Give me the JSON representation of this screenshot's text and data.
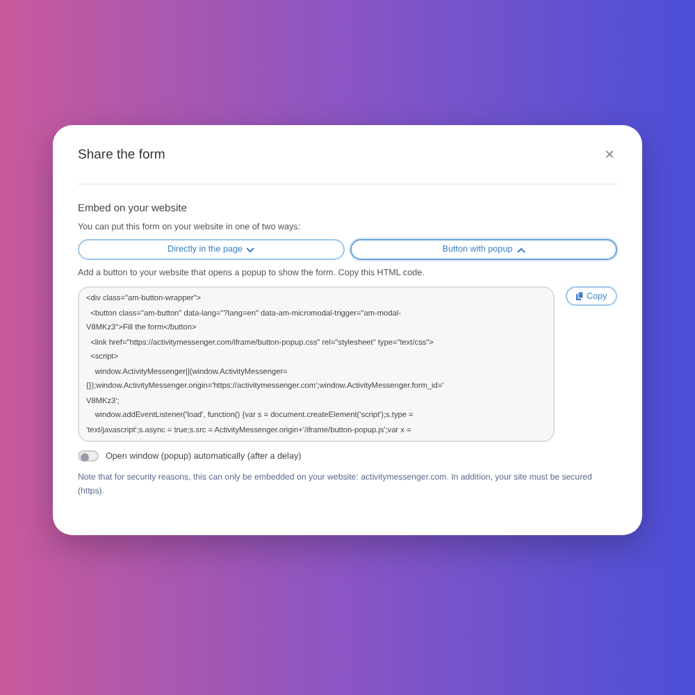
{
  "dialog": {
    "title": "Share the form",
    "close": "×"
  },
  "section_title": "Embed on your website",
  "intro": "You can put this form on your website in one of two ways:",
  "tabs": [
    {
      "label": "Directly in the page",
      "selected": false
    },
    {
      "label": "Button with popup",
      "selected": true
    }
  ],
  "instructions": "Add a button to your website that opens a popup to show the form. Copy this HTML code.",
  "code_lines": [
    "<div class=\"am-button-wrapper\">",
    "  <button class=\"am-button\" data-lang=\"?lang=en\" data-am-micromodal-trigger=\"am-modal-",
    "V8MKz3\">Fill the form</button>",
    "  <link href=\"https://activitymessenger.com/iframe/button-popup.css\" rel=\"stylesheet\" type=\"text/css\">",
    "  <script>",
    "    window.ActivityMessenger||(window.ActivityMessenger=",
    "{});window.ActivityMessenger.origin='https://activitymessenger.com';window.ActivityMessenger.form_id='",
    "V8MKz3';",
    "    window.addEventListener('load', function() {var s = document.createElement('script');s.type =",
    "'text/javascript';s.async = true;s.src = ActivityMessenger.origin+'/iframe/button-popup.js';var x ="
  ],
  "copy_button": "Copy",
  "auto_open": {
    "label": "Open window (popup) automatically (after a delay)",
    "on": false
  },
  "note": "Note that for security reasons, this can only be embedded on your website: activitymessenger.com. In addition, your site must be secured (https)."
}
